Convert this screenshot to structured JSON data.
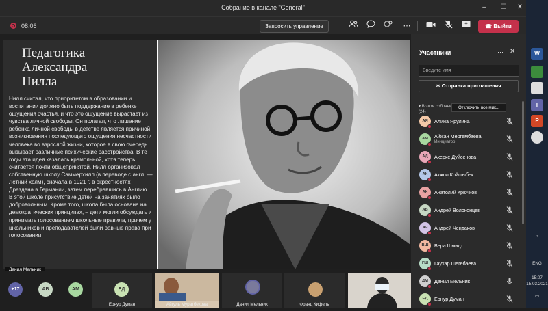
{
  "window": {
    "title": "Собрание в канале \"General\""
  },
  "toolbar": {
    "timer": "08:06",
    "control_label": "Запросить управление",
    "leave_label": "Выйти"
  },
  "slide": {
    "title": "Педагогика\nАлександра\nНилла",
    "body": "Нилл считал, что приоритетом в образовании и воспитании должно быть поддержание в ребенке ощущения счастья, и что это ощущение вырастает из чувства личной свободы. Он полагал, что лишение ребенка личной свободы в детстве является причиной возникновения последующего ощущения несчастности человека во взрослой жизни, которое в свою очередь вызывает различные психические расстройства. В те годы эта идея казалась крамольной, хотя теперь считается почти общепринятой. Нилл организовал собственную школу Саммерхилл (в переводе с англ. — Летний холм), сначала в 1921 г. в окрестностях Дрездена в Германии, затем перебравшись в Англию. В этой школе присутствие детей на занятиях было добровольным. Кроме того, школа была основана на демократических принципах, – дети могли обсуждать и принимать голосованием школьные правила, причем у школьников и преподавателей были равные права при голосовании.",
    "presenter": "Данил Мельник"
  },
  "strip": {
    "more": "+17",
    "av1": "АВ",
    "av2": "АМ",
    "t1_initials": "ЕД",
    "t1_name": "Ернур Думан",
    "t2_name": "Айгуль Муратбекова",
    "t3_name": "Данил Мельник",
    "t4_name": "Франц Кифель"
  },
  "panel": {
    "title": "Участники",
    "search_placeholder": "Введите имя",
    "invite_label": "Отправка приглашения",
    "section_label": "В этом собрании",
    "section_count": "(24)",
    "mute_all": "Отключить все мик...",
    "participants": [
      {
        "initials": "АЯ",
        "name": "Алина Ярулина",
        "role": "",
        "color": "#f4c9a8"
      },
      {
        "initials": "АМ",
        "name": "Айжан Мергембаева",
        "role": "Инициатор",
        "color": "#a8d8a0"
      },
      {
        "initials": "АД",
        "name": "Акерке Дуйсенова",
        "role": "",
        "color": "#e8a7b8"
      },
      {
        "initials": "АК",
        "name": "Акжол Койшыбек",
        "role": "",
        "color": "#b4c7e7"
      },
      {
        "initials": "АК",
        "name": "Анатолий Крючков",
        "role": "",
        "color": "#e8a2a2"
      },
      {
        "initials": "АВ",
        "name": "Андрей Волоконцев",
        "role": "",
        "color": "#c7d8c4"
      },
      {
        "initials": "АЧ",
        "name": "Андрей Чендаков",
        "role": "",
        "color": "#d3c4e6"
      },
      {
        "initials": "ВШ",
        "name": "Вера Шмидт",
        "role": "",
        "color": "#f2b8a0"
      },
      {
        "initials": "ГШ",
        "name": "Гаухар Шегебаева",
        "role": "",
        "color": "#b8dcc6"
      },
      {
        "initials": "ДМ",
        "name": "Данил Мельник",
        "role": "",
        "color": "#cfcfcf"
      },
      {
        "initials": "ЕД",
        "name": "Ернур Думан",
        "role": "",
        "color": "#c9e2b3"
      }
    ]
  },
  "taskbar": {
    "lang": "ENG",
    "time": "15:07",
    "date": "15.03.2021"
  },
  "colors": {
    "accent_red": "#c4314b",
    "panel_bg": "#2b2b2b",
    "bar_bg": "#292929"
  }
}
